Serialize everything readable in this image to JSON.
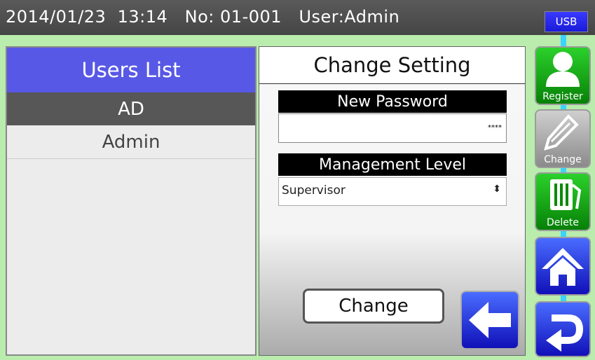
{
  "status_bar": {
    "date": "2014/01/23",
    "time": "13:14",
    "number_label": "No:",
    "number_value": "01-001",
    "user_label": "User:Admin",
    "usb": "USB"
  },
  "users_panel": {
    "title": "Users List",
    "users": [
      "AD",
      "Admin"
    ],
    "selected_user": "AD"
  },
  "settings_panel": {
    "title": "Change Setting",
    "password_label": "New Password",
    "password_value": "****",
    "level_label": "Management Level",
    "level_value": "Supervisor",
    "change_button": "Change"
  },
  "side_menu": {
    "register": "Register",
    "change": "Change",
    "delete": "Delete"
  },
  "icons": [
    "user-icon",
    "pencil-icon",
    "trash-icon",
    "home-icon",
    "return-icon",
    "back-arrow-icon"
  ],
  "colors": {
    "header_bg": "#4d4d4d",
    "accent_blue": "#5858e6",
    "green_button": "#15a815",
    "frame_green": "#b9ecad"
  }
}
